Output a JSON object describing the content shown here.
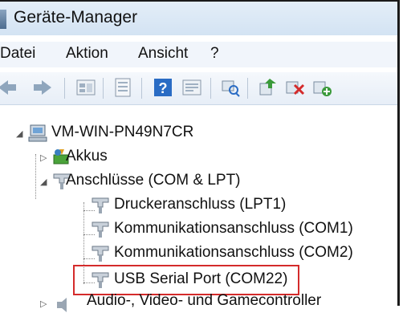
{
  "window": {
    "title": "Geräte-Manager"
  },
  "menu": {
    "items": [
      "Datei",
      "Aktion",
      "Ansicht",
      "?"
    ]
  },
  "toolbar": {
    "buttons": [
      "back-icon",
      "forward-icon",
      "properties-icon",
      "list-icon",
      "help-icon",
      "details-icon",
      "scan-hardware-icon",
      "update-driver-icon",
      "uninstall-icon",
      "add-hardware-icon"
    ]
  },
  "tree": {
    "root": "VM-WIN-PN49N7CR",
    "akkus": "Akkus",
    "ports_group": "Anschlüsse (COM & LPT)",
    "ports": [
      "Druckeranschluss (LPT1)",
      "Kommunikationsanschluss (COM1)",
      "Kommunikationsanschluss (COM2)",
      "USB Serial Port (COM22)"
    ],
    "next_group": "Audio-, Video- und Gamecontroller"
  },
  "colors": {
    "highlight": "#d42b2b",
    "accent": "#2a6cc4"
  }
}
